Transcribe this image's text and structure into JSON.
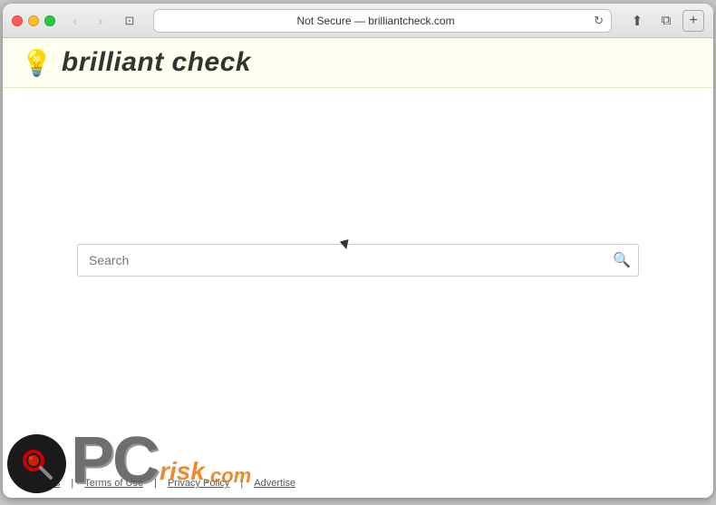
{
  "browser": {
    "title_bar": {
      "url": "Not Secure — brilliantcheck.com",
      "close_label": "×",
      "minimize_label": "−",
      "maximize_label": "+"
    },
    "nav": {
      "back_icon": "‹",
      "forward_icon": "›",
      "reader_icon": "⊡",
      "reload_icon": "↻",
      "share_icon": "⬆",
      "fullscreen_icon": "⧉",
      "new_tab_icon": "+"
    }
  },
  "site": {
    "logo_icon": "💡",
    "title": "brilliant check",
    "search_placeholder": "Search",
    "search_button_icon": "🔍"
  },
  "footer": {
    "links": [
      {
        "label": "About us"
      },
      {
        "label": "Terms of Use"
      },
      {
        "label": "Privacy Policy"
      },
      {
        "label": "Advertise"
      }
    ],
    "separator": "|"
  },
  "watermark": {
    "pc_text": "PC",
    "risk_text": "risk",
    "com_text": ".com"
  }
}
